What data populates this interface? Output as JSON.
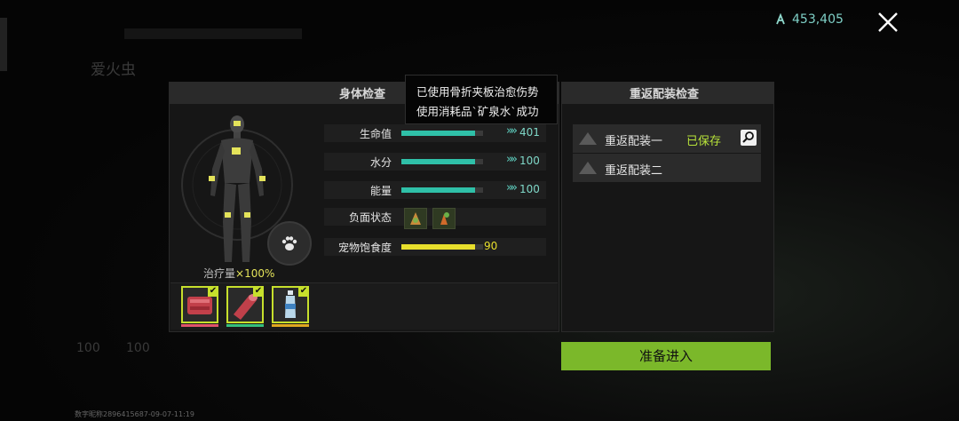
{
  "currency": {
    "icon": "coin-icon",
    "value": "453,405"
  },
  "close": {
    "icon": "close-icon"
  },
  "body_check": {
    "title": "身体检查",
    "heal_label": "治疗量",
    "heal_value": "×100%",
    "stats": [
      {
        "label": "生命值",
        "value": "401",
        "fill": 0.9,
        "color": "#2fc0a8"
      },
      {
        "label": "水分",
        "value": "100",
        "fill": 0.9,
        "color": "#2fc0a8"
      },
      {
        "label": "能量",
        "value": "100",
        "fill": 0.9,
        "color": "#2fc0a8"
      }
    ],
    "debuff_label": "负面状态",
    "pet_hunger": {
      "label": "宠物饱食度",
      "value": "90",
      "fill": 0.9,
      "color": "#e8df2c"
    },
    "items": [
      {
        "icon": "bone-splint-icon",
        "underline": "#e0546a"
      },
      {
        "icon": "bandage-roll-icon",
        "underline": "#35c07e"
      },
      {
        "icon": "mineral-water-icon",
        "underline": "#e0a820"
      }
    ]
  },
  "tooltip": {
    "line1": "已使用骨折夹板治愈伤势",
    "line2": "使用消耗品`矿泉水`成功"
  },
  "loadout_check": {
    "title": "重返配装检查",
    "loadouts": [
      {
        "label": "重返配装一",
        "status": "已保存"
      },
      {
        "label": "重返配装二",
        "status": ""
      }
    ]
  },
  "ready_button": "准备进入",
  "footer_id": "数字昵称2896415687-09-07-11:19",
  "background": {
    "title": "爱火虫",
    "stat_a": "100",
    "stat_b": "100"
  }
}
